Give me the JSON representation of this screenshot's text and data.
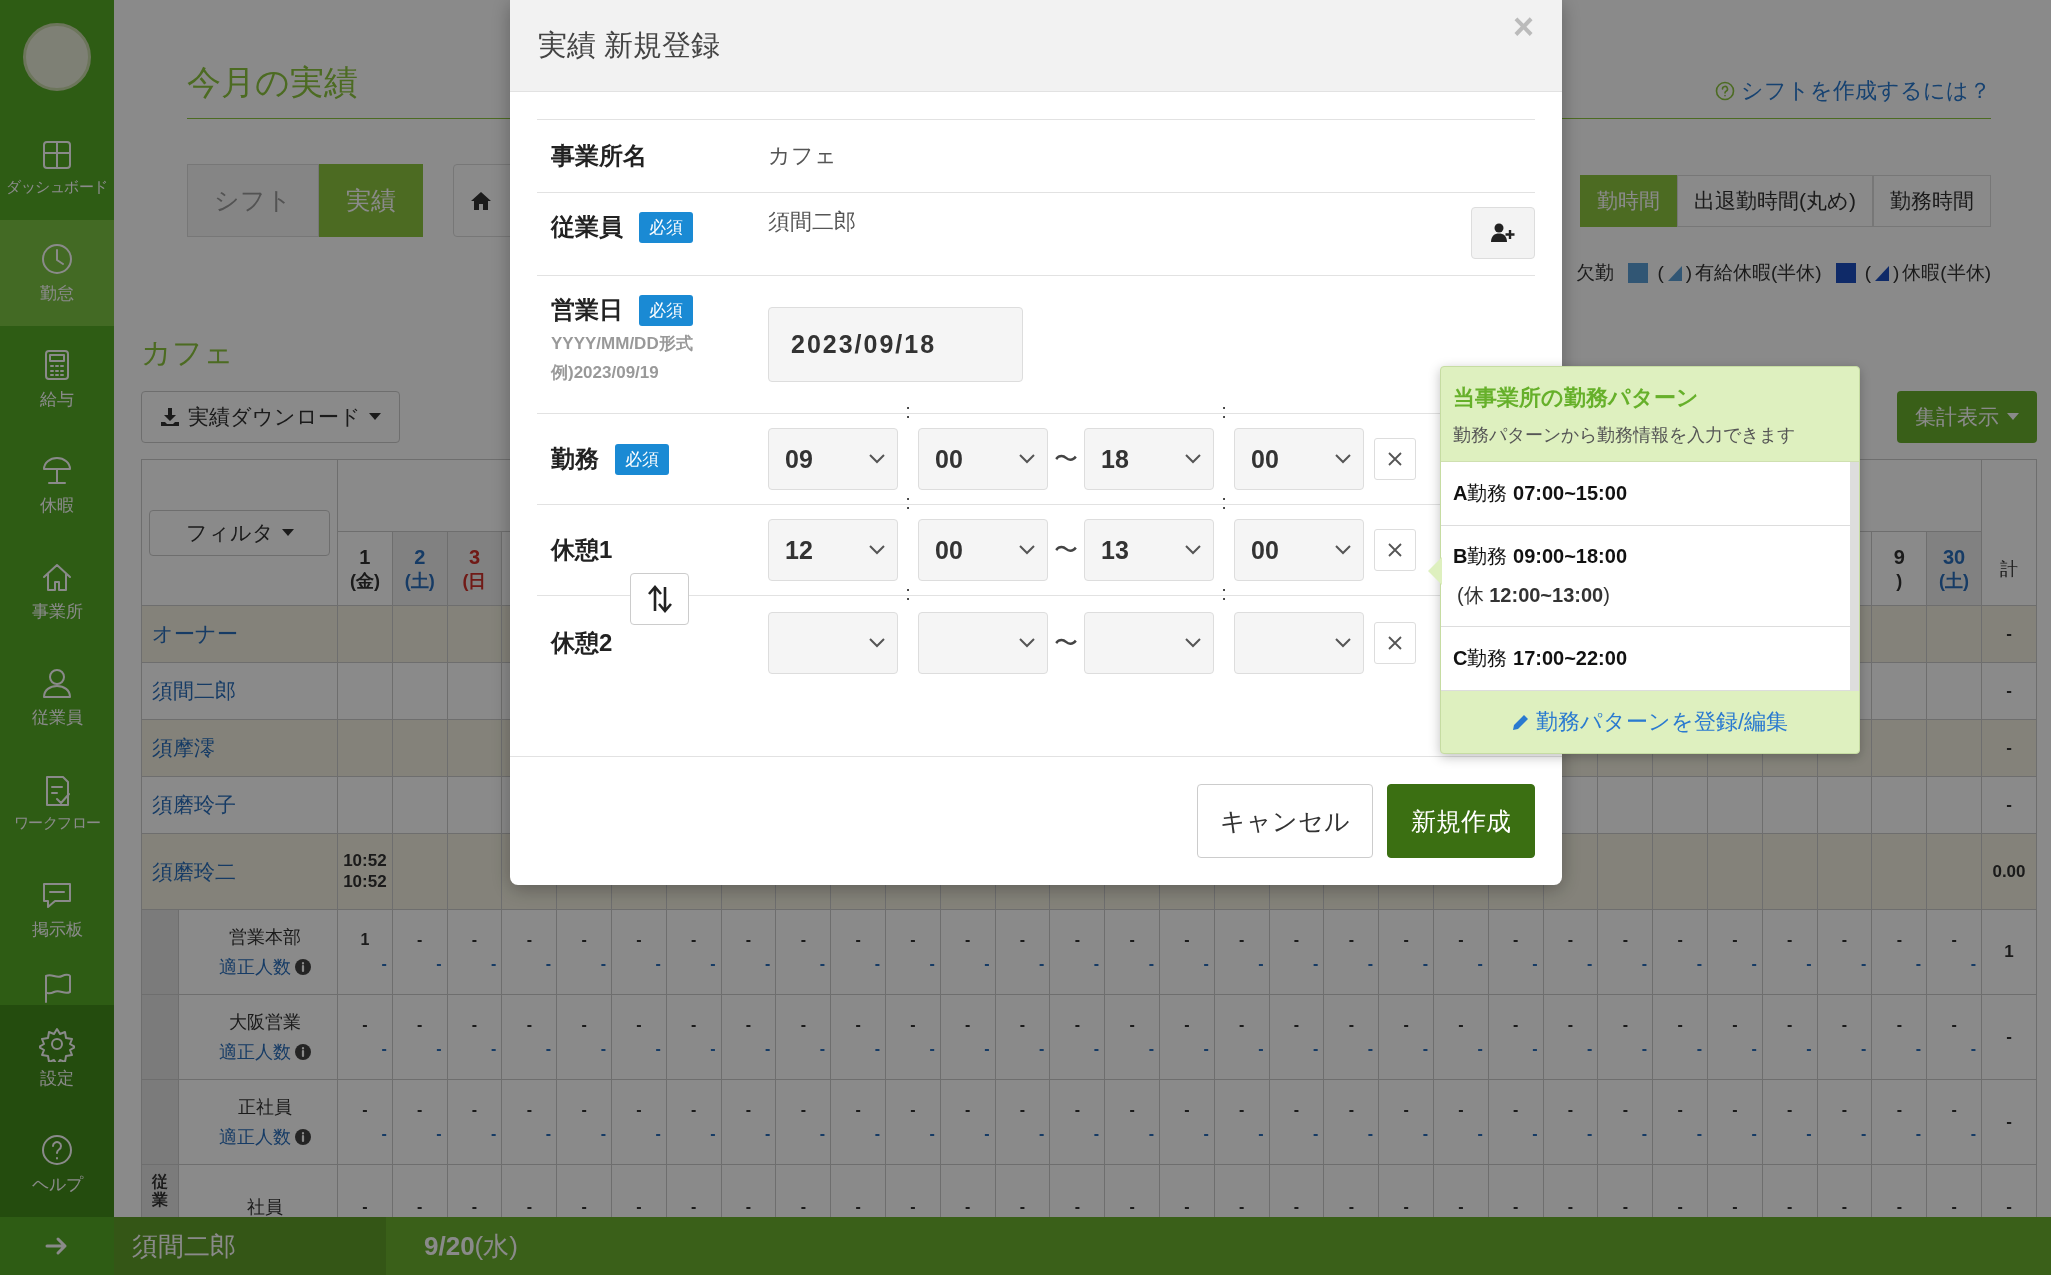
{
  "sidebar": {
    "items": [
      {
        "label": "ダッシュボード",
        "selected": false
      },
      {
        "label": "勤怠",
        "selected": true
      },
      {
        "label": "給与",
        "selected": false
      },
      {
        "label": "休暇",
        "selected": false
      },
      {
        "label": "事業所",
        "selected": false
      },
      {
        "label": "従業員",
        "selected": false
      },
      {
        "label": "ワークフロー",
        "selected": false
      },
      {
        "label": "掲示板",
        "selected": false
      },
      {
        "selected": false
      }
    ],
    "bottom_items": [
      {
        "label": "設定"
      },
      {
        "label": "ヘルプ"
      }
    ]
  },
  "header": {
    "title": "今月の実績",
    "help_link": "シフトを作成するには？"
  },
  "view_toggle": [
    {
      "label": "シフト",
      "selected": false
    },
    {
      "label": "実績",
      "selected": true
    }
  ],
  "time_toggle": [
    {
      "label": "勤時間",
      "selected": true
    },
    {
      "label": "出退勤時間(丸め)",
      "selected": false
    },
    {
      "label": "勤務時間",
      "selected": false
    }
  ],
  "legend": [
    {
      "kind": "plain",
      "label": "欠勤"
    },
    {
      "kind": "paid_leave",
      "open": "(",
      "close": ")",
      "label": "有給休暇(半休)"
    },
    {
      "kind": "leave",
      "open": "(",
      "close": ")",
      "label": "休暇(半休)"
    }
  ],
  "office": {
    "name": "カフェ",
    "download_button": "実績ダウンロード",
    "summary_button": "集計表示"
  },
  "table": {
    "filter_button": "フィルタ",
    "total_header": "計",
    "group_header": "従業",
    "days_left": [
      {
        "day": "1",
        "weekday": "(金)",
        "kind": "weekday"
      },
      {
        "day": "2",
        "weekday": "(土)",
        "kind": "saturday"
      },
      {
        "day": "3",
        "weekday": "(日",
        "kind": "sunday"
      }
    ],
    "days_right": [
      {
        "day": "9",
        "weekday": ")",
        "kind": "weekday"
      },
      {
        "day": "30",
        "weekday": "(土)",
        "kind": "saturday"
      }
    ],
    "employees": [
      {
        "name": "オーナー",
        "highlighted": true,
        "total": "-"
      },
      {
        "name": "須間二郎",
        "highlighted": false,
        "total": "-"
      },
      {
        "name": "須摩澪",
        "highlighted": true,
        "total": "-"
      },
      {
        "name": "須磨玲子",
        "highlighted": false,
        "total": "-"
      },
      {
        "name": "須磨玲二",
        "highlighted": true,
        "first_day_times": [
          "10:52",
          "10:52"
        ],
        "total": "0.00"
      }
    ],
    "groups": [
      {
        "name": "営業本部",
        "link": "適正人数",
        "total": "1",
        "counts": [
          "1",
          "-",
          "-",
          "-",
          "-",
          "-",
          "-",
          "-",
          "-",
          "-",
          "-",
          "-",
          "-",
          "-",
          "-",
          "-",
          "-",
          "-",
          "-",
          "-",
          "-",
          "-",
          "-",
          "-",
          "-",
          "-",
          "-",
          "-",
          "-",
          "-"
        ],
        "targets": [
          "-",
          "-",
          "-",
          "-",
          "-",
          "-",
          "-",
          "-",
          "-",
          "-",
          "-",
          "-",
          "-",
          "-",
          "-",
          "-",
          "-",
          "-",
          "-",
          "-",
          "-",
          "-",
          "-",
          "-",
          "-",
          "-",
          "-",
          "-",
          "-",
          "-"
        ]
      },
      {
        "name": "大阪営業",
        "link": "適正人数",
        "total": "-",
        "counts": [
          "-",
          "-",
          "-",
          "-",
          "-",
          "-",
          "-",
          "-",
          "-",
          "-",
          "-",
          "-",
          "-",
          "-",
          "-",
          "-",
          "-",
          "-",
          "-",
          "-",
          "-",
          "-",
          "-",
          "-",
          "-",
          "-",
          "-",
          "-",
          "-",
          "-"
        ],
        "targets": [
          "-",
          "-",
          "-",
          "-",
          "-",
          "-",
          "-",
          "-",
          "-",
          "-",
          "-",
          "-",
          "-",
          "-",
          "-",
          "-",
          "-",
          "-",
          "-",
          "-",
          "-",
          "-",
          "-",
          "-",
          "-",
          "-",
          "-",
          "-",
          "-",
          "-"
        ]
      },
      {
        "name": "正社員",
        "link": "適正人数",
        "total": "-",
        "counts": [
          "-",
          "-",
          "-",
          "-",
          "-",
          "-",
          "-",
          "-",
          "-",
          "-",
          "-",
          "-",
          "-",
          "-",
          "-",
          "-",
          "-",
          "-",
          "-",
          "-",
          "-",
          "-",
          "-",
          "-",
          "-",
          "-",
          "-",
          "-",
          "-",
          "-"
        ],
        "targets": [
          "-",
          "-",
          "-",
          "-",
          "-",
          "-",
          "-",
          "-",
          "-",
          "-",
          "-",
          "-",
          "-",
          "-",
          "-",
          "-",
          "-",
          "-",
          "-",
          "-",
          "-",
          "-",
          "-",
          "-",
          "-",
          "-",
          "-",
          "-",
          "-",
          "-"
        ]
      },
      {
        "name": "社員",
        "total": "-",
        "counts": [
          "-",
          "-",
          "-",
          "-",
          "-",
          "-",
          "-",
          "-",
          "-",
          "-",
          "-",
          "-",
          "-",
          "-",
          "-",
          "-",
          "-",
          "-",
          "-",
          "-",
          "-",
          "-",
          "-",
          "-",
          "-",
          "-",
          "-",
          "-",
          "-",
          "-"
        ]
      }
    ]
  },
  "bottom_bar": {
    "user": "須間二郎",
    "date": "**9/20**(水)"
  },
  "modal": {
    "title": "実績 新規登録",
    "close": "×",
    "fields": [
      {
        "kind": "text",
        "label": "事業所名",
        "value": "カフェ"
      },
      {
        "kind": "employee",
        "label": "従業員",
        "badge": "必須",
        "value": "須間二郎"
      },
      {
        "kind": "date",
        "label": "営業日",
        "badge": "必須",
        "hints": [
          "YYYY/MM/DD形式",
          "例)2023/09/19"
        ],
        "value": "2023/09/18"
      },
      {
        "kind": "time_range",
        "label": "勤務",
        "badge": "必須",
        "start_hour": "09",
        "start_minute": "00",
        "end_hour": "18",
        "end_minute": "00",
        "separators": [
          ":",
          "〜",
          ":"
        ]
      },
      {
        "kind": "time_range",
        "label": "休憩1",
        "start_hour": "12",
        "start_minute": "00",
        "end_hour": "13",
        "end_minute": "00",
        "separators": [
          ":",
          "〜",
          ":"
        ]
      },
      {
        "kind": "time_range",
        "label": "休憩2",
        "separators": [
          ":",
          "〜",
          ":"
        ]
      }
    ],
    "buttons": [
      {
        "kind": "secondary",
        "label": "キャンセル"
      },
      {
        "kind": "primary",
        "label": "新規作成"
      }
    ]
  },
  "pattern_popover": {
    "title": "当事業所の勤務パターン",
    "subtitle": "勤務パターンから勤務情報を入力できます",
    "patterns": [
      {
        "text": "**A**勤務 **07:00~15:00**"
      },
      {
        "text": "**B**勤務 **09:00~18:00**",
        "break": "(休 **12:00~13:00**)"
      },
      {
        "text": "**C**勤務 **17:00~22:00**"
      }
    ],
    "edit_link": "勤務パターンを登録/編集"
  }
}
